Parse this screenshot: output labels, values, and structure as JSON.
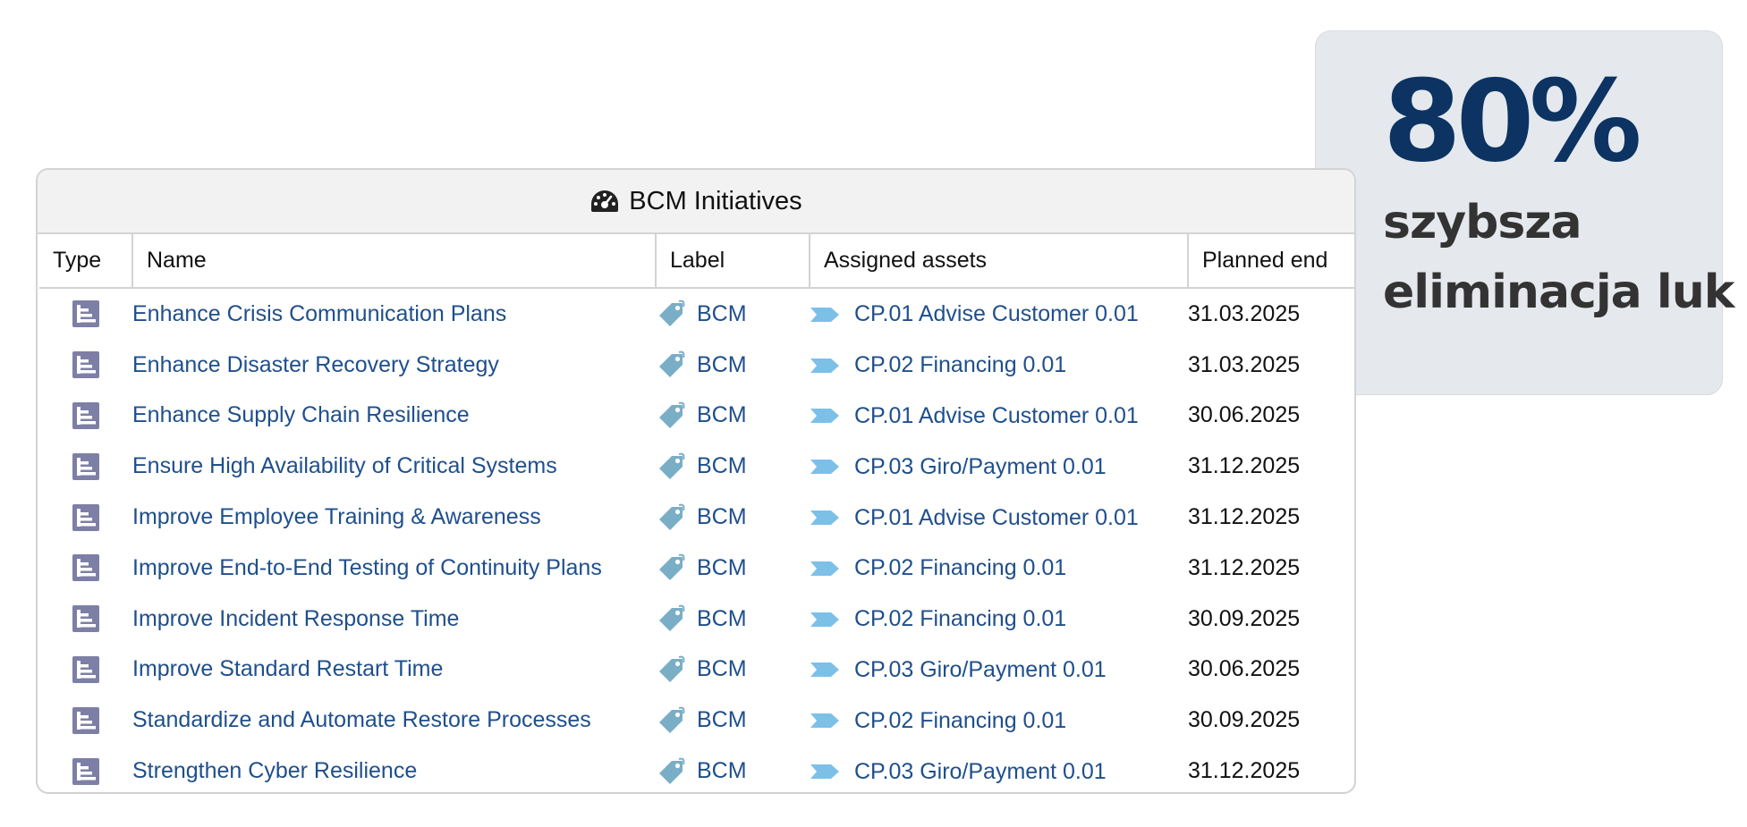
{
  "stat": {
    "value": "80%",
    "caption_line1": "szybsza",
    "caption_line2": "eliminacja luk"
  },
  "widget": {
    "title": "BCM Initiatives",
    "title_icon": "dashboard-gauge-icon",
    "columns": {
      "type": "Type",
      "name": "Name",
      "label": "Label",
      "assets": "Assigned assets",
      "planned_end": "Planned end"
    },
    "rows": [
      {
        "type_icon": "initiative-icon",
        "name": "Enhance Crisis Communication Plans",
        "label": "BCM",
        "asset": "CP.01 Advise Customer 0.01",
        "end": "31.03.2025"
      },
      {
        "type_icon": "initiative-icon",
        "name": "Enhance Disaster Recovery Strategy",
        "label": "BCM",
        "asset": "CP.02 Financing 0.01",
        "end": "31.03.2025"
      },
      {
        "type_icon": "initiative-icon",
        "name": "Enhance Supply Chain Resilience",
        "label": "BCM",
        "asset": "CP.01 Advise Customer 0.01",
        "end": "30.06.2025"
      },
      {
        "type_icon": "initiative-icon",
        "name": "Ensure High Availability of Critical Systems",
        "label": "BCM",
        "asset": "CP.03 Giro/Payment 0.01",
        "end": "31.12.2025"
      },
      {
        "type_icon": "initiative-icon",
        "name": "Improve Employee Training & Awareness",
        "label": "BCM",
        "asset": "CP.01 Advise Customer 0.01",
        "end": "31.12.2025"
      },
      {
        "type_icon": "initiative-icon",
        "name": "Improve End-to-End Testing of Continuity Plans",
        "label": "BCM",
        "asset": "CP.02 Financing 0.01",
        "end": "31.12.2025"
      },
      {
        "type_icon": "initiative-icon",
        "name": "Improve Incident Response Time",
        "label": "BCM",
        "asset": "CP.02 Financing 0.01",
        "end": "30.09.2025"
      },
      {
        "type_icon": "initiative-icon",
        "name": "Improve Standard Restart Time",
        "label": "BCM",
        "asset": "CP.03 Giro/Payment 0.01",
        "end": "30.06.2025"
      },
      {
        "type_icon": "initiative-icon",
        "name": "Standardize and Automate Restore Processes",
        "label": "BCM",
        "asset": "CP.02 Financing 0.01",
        "end": "30.09.2025"
      },
      {
        "type_icon": "initiative-icon",
        "name": "Strengthen Cyber Resilience",
        "label": "BCM",
        "asset": "CP.03 Giro/Payment 0.01",
        "end": "31.12.2025"
      }
    ]
  },
  "colors": {
    "stat_value": "#0c3362",
    "stat_caption": "#333333",
    "stat_bg": "#e5e9ee",
    "link": "#1f4f8c",
    "type_icon": "#7d7fa6",
    "label_icon": "#7aaec6",
    "asset_icon": "#7cc0e8"
  }
}
